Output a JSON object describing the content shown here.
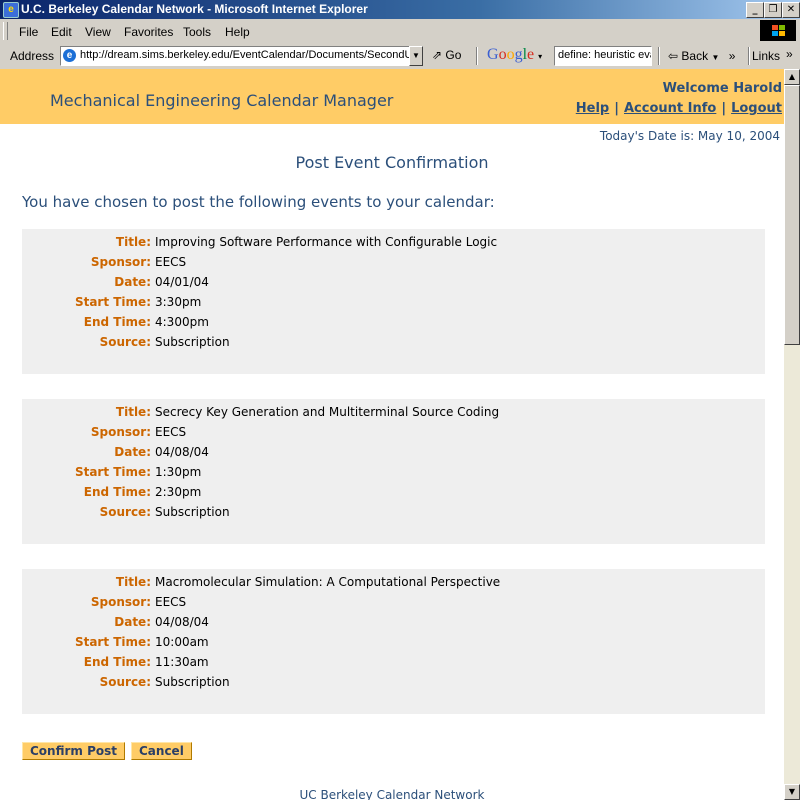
{
  "window": {
    "title": "U.C. Berkeley Calendar Network - Microsoft Internet Explorer",
    "app_icon": "e"
  },
  "menubar": {
    "items": [
      "File",
      "Edit",
      "View",
      "Favorites",
      "Tools",
      "Help"
    ]
  },
  "addressbar": {
    "label": "Address",
    "url": "http://dream.sims.berkeley.edu/EventCalendar/Documents/SecondUser",
    "go_label": "Go",
    "google_logo": "Google",
    "search_value": "define: heuristic eva",
    "back_label": "Back",
    "links_label": "Links"
  },
  "header": {
    "app_title": "Mechanical Engineering Calendar Manager",
    "welcome": "Welcome Harold",
    "help": "Help",
    "account_info": "Account Info",
    "logout": "Logout",
    "separator": "|"
  },
  "today": "Today's Date is: May 10, 2004",
  "page_title": "Post Event Confirmation",
  "intro": "You have chosen to post the following events to your calendar:",
  "labels": {
    "title": "Title:",
    "sponsor": "Sponsor:",
    "date": "Date:",
    "start_time": "Start Time:",
    "end_time": "End Time:",
    "source": "Source:"
  },
  "events": [
    {
      "title": "Improving Software Performance with Configurable Logic",
      "sponsor": "EECS",
      "date": "04/01/04",
      "start_time": "3:30pm",
      "end_time": "4:300pm",
      "source": "Subscription"
    },
    {
      "title": "Secrecy Key Generation and Multiterminal Source Coding",
      "sponsor": "EECS",
      "date": "04/08/04",
      "start_time": "1:30pm",
      "end_time": "2:30pm",
      "source": "Subscription"
    },
    {
      "title": "Macromolecular Simulation: A Computational Perspective",
      "sponsor": "EECS",
      "date": "04/08/04",
      "start_time": "10:00am",
      "end_time": "11:30am",
      "source": "Subscription"
    }
  ],
  "buttons": {
    "confirm": "Confirm Post",
    "cancel": "Cancel"
  },
  "footer": "UC Berkeley Calendar Network",
  "colors": {
    "header_bg": "#ffcc66",
    "text_blue": "#2b4f7a",
    "label_orange": "#cc6600",
    "event_bg": "#efefef"
  }
}
